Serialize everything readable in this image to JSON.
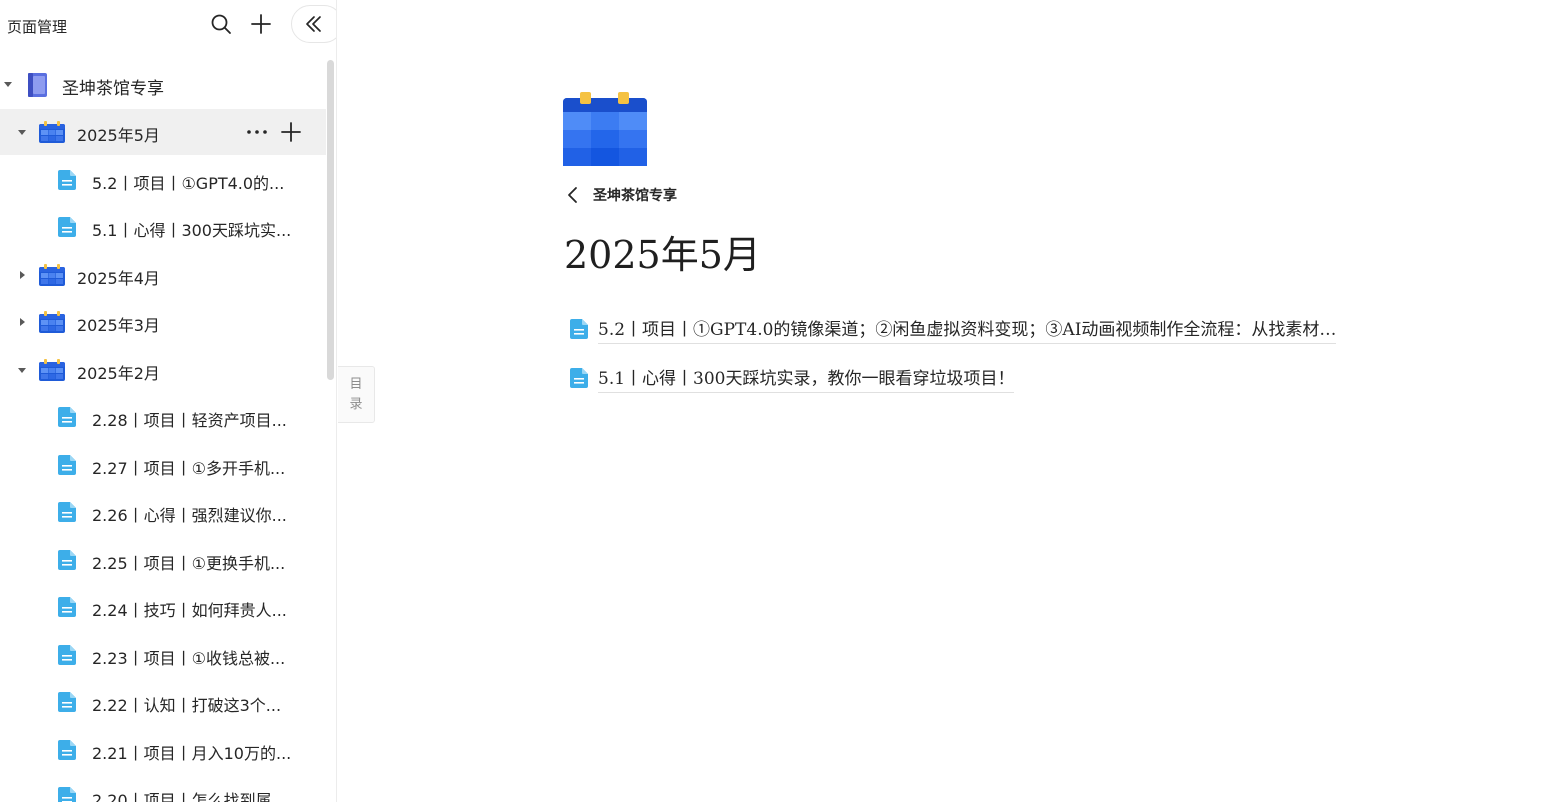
{
  "sidebar": {
    "title": "页面管理",
    "root": {
      "label": "圣坤茶馆专享"
    },
    "items": [
      {
        "label": "2025年5月",
        "type": "folder",
        "expanded": true,
        "active": true
      },
      {
        "label": "5.2丨项目丨①GPT4.0的...",
        "type": "doc"
      },
      {
        "label": "5.1丨心得丨300天踩坑实...",
        "type": "doc"
      },
      {
        "label": "2025年4月",
        "type": "folder",
        "expanded": false
      },
      {
        "label": "2025年3月",
        "type": "folder",
        "expanded": false
      },
      {
        "label": "2025年2月",
        "type": "folder",
        "expanded": true
      },
      {
        "label": "2.28丨项目丨轻资产项目...",
        "type": "doc"
      },
      {
        "label": "2.27丨项目丨①多开手机...",
        "type": "doc"
      },
      {
        "label": "2.26丨心得丨强烈建议你...",
        "type": "doc"
      },
      {
        "label": "2.25丨项目丨①更换手机...",
        "type": "doc"
      },
      {
        "label": "2.24丨技巧丨如何拜贵人...",
        "type": "doc"
      },
      {
        "label": "2.23丨项目丨①收钱总被...",
        "type": "doc"
      },
      {
        "label": "2.22丨认知丨打破这3个...",
        "type": "doc"
      },
      {
        "label": "2.21丨项目丨月入10万的...",
        "type": "doc"
      },
      {
        "label": "2.20丨项目丨怎么找到属...",
        "type": "doc"
      }
    ],
    "toc_label": [
      "目",
      "录"
    ]
  },
  "main": {
    "breadcrumb": "圣坤茶馆专享",
    "title": "2025年5月",
    "docs": [
      {
        "label": "5.2丨项目丨①GPT4.0的镜像渠道；②闲鱼虚拟资料变现；③AI动画视频制作全流程：从找素材…"
      },
      {
        "label": "5.1丨心得丨300天踩坑实录，教你一眼看穿垃圾项目！"
      }
    ]
  },
  "colors": {
    "calendar_blue": "#1f5bd8",
    "calendar_tab": "#f5c242",
    "doc_icon": "#3daee9",
    "book_icon": "#5a6fe0"
  }
}
